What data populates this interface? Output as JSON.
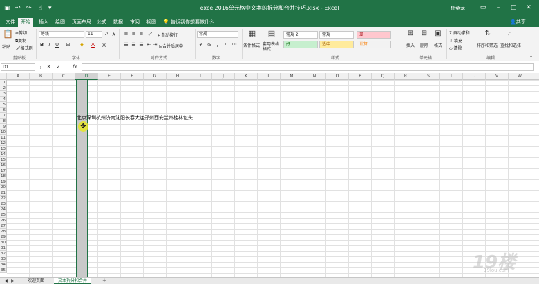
{
  "titlebar": {
    "title": "excel2016单元格中文本的拆分和合并技巧.xlsx - Excel",
    "user": "杨金龙",
    "save_icon": "save-icon",
    "undo_icon": "undo-icon",
    "redo_icon": "redo-icon",
    "touch_icon": "touch-mode-icon"
  },
  "tabs": {
    "items": [
      "文件",
      "开始",
      "插入",
      "绘图",
      "页面布局",
      "公式",
      "数据",
      "审阅",
      "视图"
    ],
    "active": "开始",
    "tell_me": "告诉我你想要做什么",
    "share": "共享"
  },
  "ribbon": {
    "clipboard": {
      "paste": "粘贴",
      "cut": "剪切",
      "copy": "复制",
      "format_painter": "格式刷",
      "label": "剪贴板"
    },
    "font": {
      "name": "等线",
      "size": "11",
      "bold": "B",
      "italic": "I",
      "underline": "U",
      "label": "字体"
    },
    "alignment": {
      "wrap": "自动换行",
      "merge": "合并后居中",
      "label": "对齐方式"
    },
    "number": {
      "format": "常规",
      "label": "数字"
    },
    "styles": {
      "conditional": "条件格式",
      "table": "套用表格格式",
      "cells": [
        {
          "text": "常规 2",
          "bg": "#ffffff",
          "color": "#222222"
        },
        {
          "text": "常规",
          "bg": "#ffffff",
          "color": "#222222"
        },
        {
          "text": "差",
          "bg": "#ffc7ce",
          "color": "#9c0006"
        },
        {
          "text": "好",
          "bg": "#c6efce",
          "color": "#006100"
        },
        {
          "text": "适中",
          "bg": "#ffeb9c",
          "color": "#9c5700"
        },
        {
          "text": "计算",
          "bg": "#f2f2f2",
          "color": "#fa7d00"
        }
      ],
      "label": "样式"
    },
    "cells_group": {
      "insert": "插入",
      "delete": "删除",
      "format": "格式",
      "label": "单元格"
    },
    "editing": {
      "autosum": "自动求和",
      "fill": "填充",
      "clear": "清除",
      "sort": "排序和筛选",
      "find": "查找和选择",
      "label": "编辑"
    }
  },
  "formula_bar": {
    "name_box": "D1",
    "fx": "fx",
    "value": ""
  },
  "grid": {
    "columns": [
      "A",
      "B",
      "C",
      "D",
      "E",
      "F",
      "G",
      "H",
      "I",
      "J",
      "K",
      "L",
      "M",
      "N",
      "O",
      "P",
      "Q",
      "R",
      "S",
      "T",
      "U",
      "V",
      "W",
      "X"
    ],
    "rows": [
      "1",
      "2",
      "3",
      "4",
      "5",
      "6",
      "7",
      "8",
      "9",
      "10",
      "11",
      "12",
      "13",
      "14",
      "15",
      "16",
      "17",
      "18",
      "19",
      "20",
      "21",
      "22",
      "23",
      "24",
      "25",
      "26",
      "27",
      "28",
      "29",
      "30",
      "31",
      "32",
      "33",
      "34",
      "35"
    ],
    "selected_column": "D",
    "cell_text": "北京深圳杭州济南沈阳长春大连郑州西安兰州桂林包头",
    "cursor_glyph": "✥"
  },
  "sheets": {
    "tabs": [
      "欢迎页面",
      "文本拆分和合并"
    ],
    "active": "文本拆分和合并",
    "add": "+"
  },
  "watermark": {
    "text": "19楼",
    "sub": "19lou.com"
  }
}
